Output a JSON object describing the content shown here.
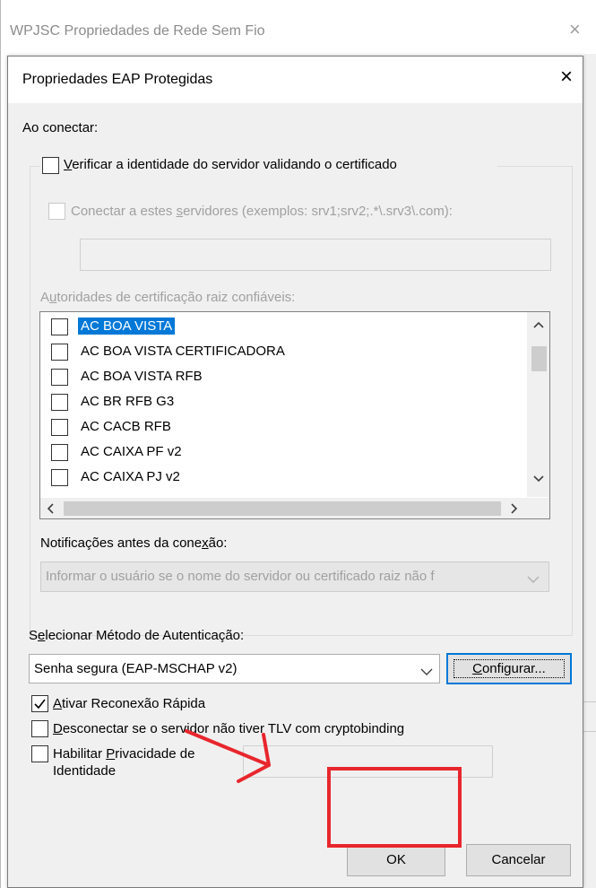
{
  "outer_window": {
    "title": "WPJSC Propriedades de Rede Sem Fio",
    "close_symbol": "×"
  },
  "dialog": {
    "title": "Propriedades EAP Protegidas",
    "close_symbol": "×",
    "on_connect_label": "Ao conectar:",
    "verify_server": {
      "prefix": "",
      "mnemonic": "V",
      "rest": "erificar a identidade do servidor validando o certificado",
      "checked": false
    },
    "connect_servers": {
      "prefix": "Conectar a estes ",
      "mnemonic": "s",
      "rest": "ervidores (exemplos: srv1;srv2;.*\\.srv3\\.com):",
      "checked": false,
      "value": ""
    },
    "trusted_ca_label": {
      "prefix": "A",
      "mnemonic": "u",
      "rest": "toridades de certificação raiz confiáveis:"
    },
    "ca_list": [
      {
        "label": "AC BOA VISTA",
        "checked": false,
        "selected": true
      },
      {
        "label": "AC BOA VISTA CERTIFICADORA",
        "checked": false,
        "selected": false
      },
      {
        "label": "AC BOA VISTA RFB",
        "checked": false,
        "selected": false
      },
      {
        "label": "AC BR RFB G3",
        "checked": false,
        "selected": false
      },
      {
        "label": "AC CACB RFB",
        "checked": false,
        "selected": false
      },
      {
        "label": "AC CAIXA PF v2",
        "checked": false,
        "selected": false
      },
      {
        "label": "AC CAIXA PJ v2",
        "checked": false,
        "selected": false
      }
    ],
    "notifications_label": {
      "prefix": "Notificações antes da cone",
      "mnemonic": "x",
      "rest": "ão:"
    },
    "notifications_value": "Informar o usuário se o nome do servidor ou certificado raiz não f",
    "auth_method_label": {
      "prefix": "S",
      "mnemonic": "e",
      "rest": "lecionar Método de Autenticação:"
    },
    "auth_method_value": "Senha segura (EAP-MSCHAP v2)",
    "configure_button": {
      "prefix": "",
      "mnemonic": "C",
      "rest": "onfigurar..."
    },
    "fast_reconnect": {
      "prefix": "",
      "mnemonic": "A",
      "rest": "tivar Reconexão Rápida",
      "checked": true
    },
    "disconnect_tlv": {
      "prefix": "",
      "mnemonic": "D",
      "rest": "esconectar se o servidor não tiver TLV com cryptobinding",
      "checked": false
    },
    "identity_privacy": {
      "line1_prefix": "Habilitar ",
      "line1_mnemonic": "P",
      "line1_rest": "rivacidade de",
      "line2": "Identidade",
      "checked": false,
      "value": ""
    },
    "ok_label": "OK",
    "cancel_label": "Cancelar"
  },
  "annotation": {
    "color": "#e8262d"
  }
}
